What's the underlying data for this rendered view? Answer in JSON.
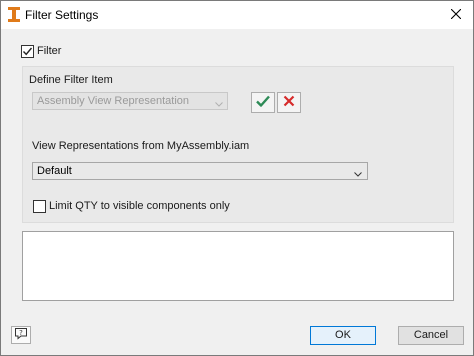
{
  "window": {
    "title": "Filter Settings",
    "app_icon": "inventor-icon",
    "close_icon": "close-icon"
  },
  "filter": {
    "label": "Filter",
    "checked": true
  },
  "define_group": {
    "title": "Define Filter Item",
    "filter_item": {
      "selected": "Assembly View Representation",
      "disabled": true
    },
    "apply_icon": "checkmark-icon",
    "clear_icon": "red-x-icon",
    "view_rep_label": "View Representations from MyAssembly.iam",
    "view_rep_select": {
      "selected": "Default"
    },
    "limit_qty": {
      "label": "Limit QTY to visible components only",
      "checked": false
    }
  },
  "buttons": {
    "ok": "OK",
    "cancel": "Cancel",
    "help_icon": "help-icon"
  },
  "colors": {
    "checkmark": "#2e8b57",
    "red_x": "#d62b2b",
    "app_icon": "#e07b1a",
    "ok_border": "#0078d7"
  }
}
